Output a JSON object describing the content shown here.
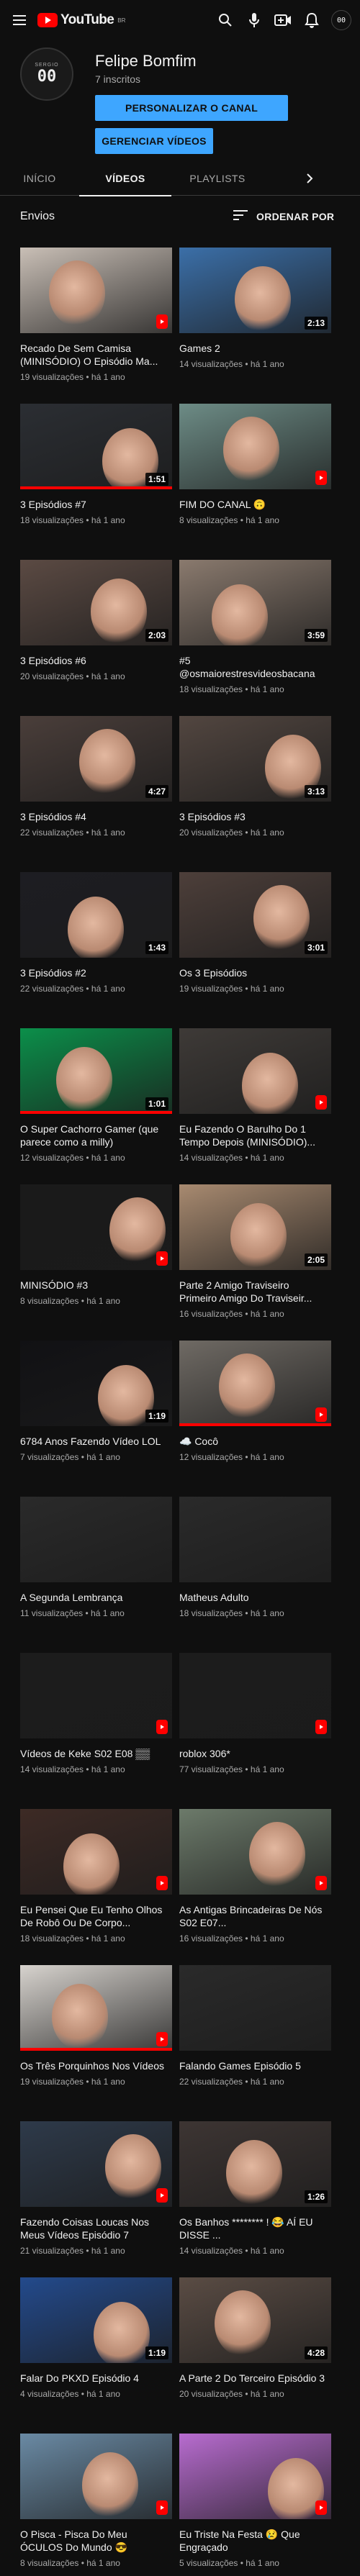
{
  "header": {
    "logo_text": "YouTube",
    "logo_superscript": "BR",
    "icons": [
      "menu-icon",
      "search-icon",
      "microphone-icon",
      "create-video-icon",
      "notifications-bell-icon",
      "account-avatar"
    ],
    "avatar_text": "00"
  },
  "channel": {
    "name": "Felipe Bomfim",
    "subscribers": "7 inscritos",
    "avatar_number": "00",
    "avatar_caption": "SERGIO",
    "customize_button": "PERSONALIZAR O CANAL",
    "manage_button": "GERENCIAR VÍDEOS"
  },
  "tabs": [
    {
      "label": "INÍCIO",
      "active": false
    },
    {
      "label": "VÍDEOS",
      "active": true
    },
    {
      "label": "PLAYLISTS",
      "active": false
    }
  ],
  "section": {
    "title": "Envios",
    "sort_label": "ORDENAR POR"
  },
  "videos": [
    {
      "title": "Recado De Sem Camisa (MINISÓDIO) O Episódio Ma...",
      "meta": "19 visualizações • há 1 ano",
      "badge": "shorts",
      "duration": "",
      "progress": 0
    },
    {
      "title": "Games 2",
      "meta": "14 visualizações • há 1 ano",
      "badge": "duration",
      "duration": "2:13",
      "progress": 0
    },
    {
      "title": "3 Episódios #7",
      "meta": "18 visualizações • há 1 ano",
      "badge": "duration",
      "duration": "1:51",
      "progress": 1.0
    },
    {
      "title": "FIM DO CANAL 🙃",
      "meta": "8 visualizações • há 1 ano",
      "badge": "shorts",
      "duration": "",
      "progress": 0
    },
    {
      "title": "3 Episódios #6",
      "meta": "20 visualizações • há 1 ano",
      "badge": "duration",
      "duration": "2:03",
      "progress": 0
    },
    {
      "title": "#5 @osmaiorestresvideosbacana",
      "meta": "18 visualizações • há 1 ano",
      "badge": "duration",
      "duration": "3:59",
      "progress": 0
    },
    {
      "title": "3 Episódios #4",
      "meta": "22 visualizações • há 1 ano",
      "badge": "duration",
      "duration": "4:27",
      "progress": 0
    },
    {
      "title": "3 Episódios #3",
      "meta": "20 visualizações • há 1 ano",
      "badge": "duration",
      "duration": "3:13",
      "progress": 0
    },
    {
      "title": "3 Episódios #2",
      "meta": "22 visualizações • há 1 ano",
      "badge": "duration",
      "duration": "1:43",
      "progress": 0
    },
    {
      "title": "Os 3 Episódios",
      "meta": "19 visualizações • há 1 ano",
      "badge": "duration",
      "duration": "3:01",
      "progress": 0
    },
    {
      "title": "O Super Cachorro Gamer (que parece como a milly)",
      "meta": "12 visualizações • há 1 ano",
      "badge": "duration",
      "duration": "1:01",
      "progress": 1.0
    },
    {
      "title": "Eu Fazendo O Barulho Do 1 Tempo Depois (MINISÓDIO)...",
      "meta": "14 visualizações • há 1 ano",
      "badge": "shorts",
      "duration": "",
      "progress": 0
    },
    {
      "title": "MINISÓDIO #3",
      "meta": "8 visualizações • há 1 ano",
      "badge": "shorts",
      "duration": "",
      "progress": 0
    },
    {
      "title": "Parte 2 Amigo Traviseiro Primeiro Amigo Do Traviseir...",
      "meta": "16 visualizações • há 1 ano",
      "badge": "duration",
      "duration": "2:05",
      "progress": 0
    },
    {
      "title": "6784 Anos Fazendo Vídeo LOL",
      "meta": "7 visualizações • há 1 ano",
      "badge": "duration",
      "duration": "1:19",
      "progress": 0
    },
    {
      "title": "☁️ Cocô",
      "meta": "12 visualizações • há 1 ano",
      "badge": "shorts",
      "duration": "",
      "progress": 1.0
    },
    {
      "title": "A Segunda Lembrança",
      "meta": "11 visualizações • há 1 ano",
      "badge": "none",
      "duration": "",
      "progress": 0
    },
    {
      "title": "Matheus Adulto",
      "meta": "18 visualizações • há 1 ano",
      "badge": "none",
      "duration": "",
      "progress": 0
    },
    {
      "title": "Vídeos de Keke S02 E08 ▒▒",
      "meta": "14 visualizações • há 1 ano",
      "badge": "shorts",
      "duration": "",
      "progress": 0
    },
    {
      "title": "roblox 306*",
      "meta": "77 visualizações • há 1 ano",
      "badge": "shorts",
      "duration": "",
      "progress": 0
    },
    {
      "title": "Eu Pensei Que Eu Tenho Olhos De Robô Ou De Corpo...",
      "meta": "18 visualizações • há 1 ano",
      "badge": "shorts",
      "duration": "",
      "progress": 0
    },
    {
      "title": "As Antigas Brincadeiras De Nós S02 E07...",
      "meta": "16 visualizações • há 1 ano",
      "badge": "shorts",
      "duration": "",
      "progress": 0
    },
    {
      "title": "Os Três Porquinhos Nos Vídeos",
      "meta": "19 visualizações • há 1 ano",
      "badge": "shorts",
      "duration": "",
      "progress": 1.0
    },
    {
      "title": "Falando Games Episódio 5",
      "meta": "22 visualizações • há 1 ano",
      "badge": "none",
      "duration": "",
      "progress": 0
    },
    {
      "title": "Fazendo Coisas Loucas Nos Meus Vídeos Episódio 7",
      "meta": "21 visualizações • há 1 ano",
      "badge": "shorts",
      "duration": "",
      "progress": 0
    },
    {
      "title": "Os Banhos ******** ! 😂 AÍ EU DISSE ...",
      "meta": "14 visualizações • há 1 ano",
      "badge": "duration",
      "duration": "1:26",
      "progress": 0
    },
    {
      "title": "Falar Do PKXD Episódio 4",
      "meta": "4 visualizações • há 1 ano",
      "badge": "duration",
      "duration": "1:19",
      "progress": 0
    },
    {
      "title": "A Parte 2 Do Terceiro Episódio 3",
      "meta": "20 visualizações • há 1 ano",
      "badge": "duration",
      "duration": "4:28",
      "progress": 0
    },
    {
      "title": "O Pisca - Pisca Do Meu ÓCULOS Do Mundo 😎",
      "meta": "8 visualizações • há 1 ano",
      "badge": "shorts",
      "duration": "",
      "progress": 0
    },
    {
      "title": "Eu Triste Na Festa 😢 Que Engraçado",
      "meta": "5 visualizações • há 1 ano",
      "badge": "shorts",
      "duration": "",
      "progress": 0
    }
  ],
  "thumb_colors": [
    "#c9bfb6",
    "#3b6fa8",
    "#2b2e33",
    "#6d8c86",
    "#5b4a43",
    "#8a7a6e",
    "#4a3e3a",
    "#524640",
    "#1d1d22",
    "#4d3f3a",
    "#0b8f4a",
    "#3e3a37",
    "#1a1a1a",
    "#a88a70",
    "#111114",
    "#6f6a64",
    "#2a2a2a",
    "#2a2a2a",
    "#1c1c1c",
    "#1c1c1c",
    "#3d2a25",
    "#6c7a6a",
    "#d7d3ce",
    "#2a2a2a",
    "#2e3a4a",
    "#3d3533",
    "#234a8c",
    "#5a4c44",
    "#6a8aa4",
    "#b86cd0"
  ]
}
